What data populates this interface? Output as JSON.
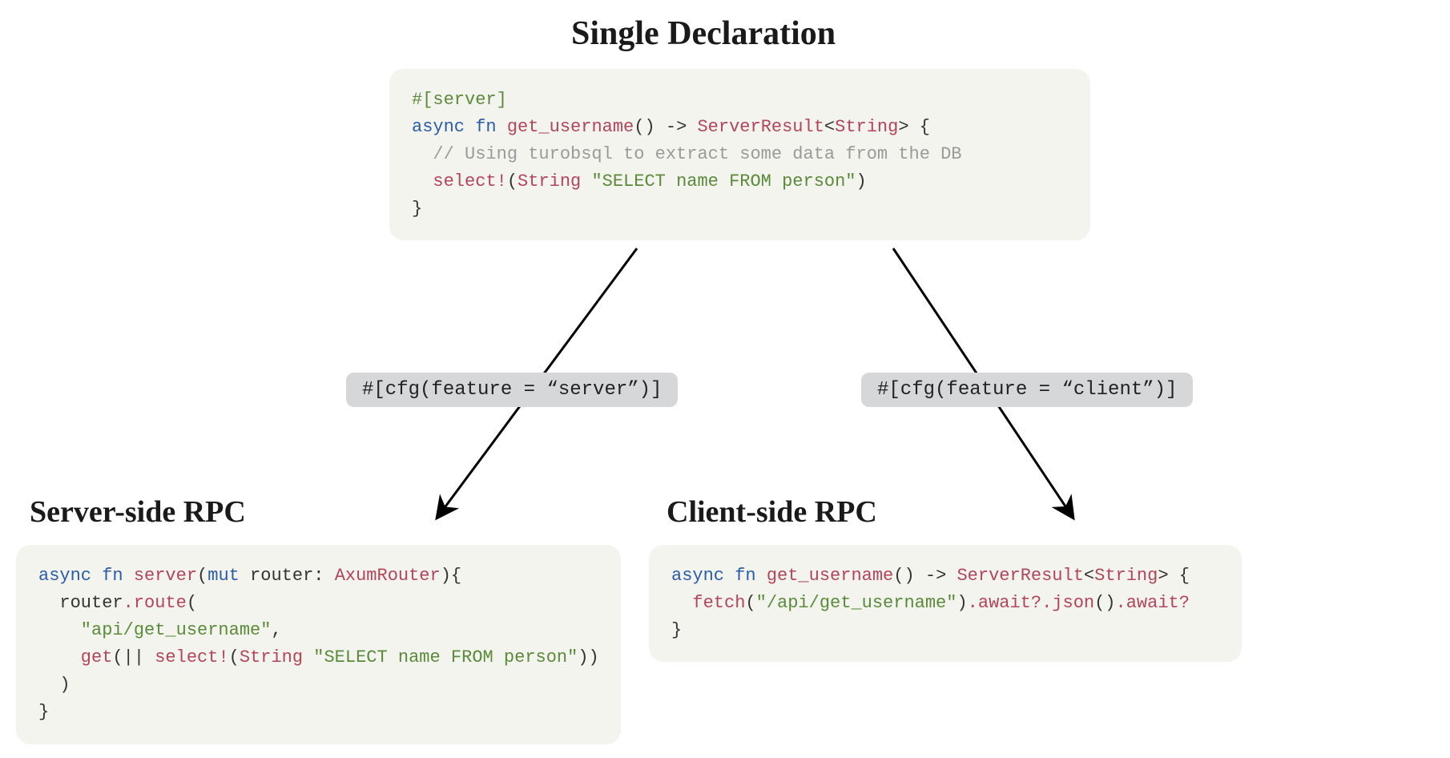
{
  "title": "Single Declaration",
  "top_code": {
    "l1a": "#[server]",
    "l2a": "async fn",
    "l2b": " get_username",
    "l2c": "() -> ",
    "l2d": "ServerResult",
    "l2e": "<",
    "l2f": "String",
    "l2g": "> {",
    "l3": "  // Using turobsql to extract some data from the DB",
    "l4a": "  select!",
    "l4b": "(",
    "l4c": "String",
    "l4d": " \"SELECT name FROM person\"",
    "l4e": ")",
    "l5": "}"
  },
  "cfg_left": "#[cfg(feature = “server”)]",
  "cfg_right": "#[cfg(feature = “client”)]",
  "left_title": "Server-side RPC",
  "right_title": "Client-side RPC",
  "left_code": {
    "l1a": "async fn",
    "l1b": " server",
    "l1c": "(",
    "l1d": "mut",
    "l1e": " router",
    "l1f": ": ",
    "l1g": "AxumRouter",
    "l1h": "){",
    "l2a": "  router",
    "l2b": ".route",
    "l2c": "(",
    "l3a": "    \"api/get_username\"",
    "l3b": ",",
    "l4a": "    get",
    "l4b": "(|| ",
    "l4c": "select!",
    "l4d": "(",
    "l4e": "String",
    "l4f": " \"SELECT name FROM person\"",
    "l4g": "))",
    "l5": "  )",
    "l6": "}"
  },
  "right_code": {
    "l1a": "async fn",
    "l1b": " get_username",
    "l1c": "() -> ",
    "l1d": "ServerResult",
    "l1e": "<",
    "l1f": "String",
    "l1g": "> {",
    "l2a": "  fetch",
    "l2b": "(",
    "l2c": "\"/api/get_username\"",
    "l2d": ")",
    "l2e": ".await?.json",
    "l2f": "()",
    "l2g": ".await?",
    "l3": "}"
  }
}
